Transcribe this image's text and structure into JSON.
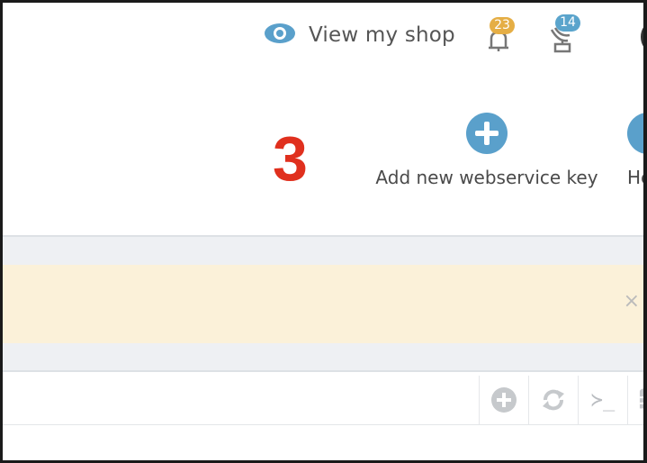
{
  "header": {
    "view_shop_label": "View my shop",
    "notifications_count": "23",
    "customers_count": "14",
    "icons": [
      "eye-icon",
      "bell-icon",
      "customers-icon",
      "avatar-icon"
    ]
  },
  "annotation": {
    "step_number": "3"
  },
  "toolbar": {
    "add_key_label": "Add new webservice key",
    "help_label": "He"
  },
  "alert": {
    "close_symbol": "×"
  },
  "panel": {
    "tools": [
      "add-icon",
      "refresh-icon",
      "sql-query-icon",
      "database-icon"
    ],
    "sql_symbol": "≻_"
  },
  "colors": {
    "accent_blue": "#5aa0cb",
    "badge_orange": "#e5ae45",
    "badge_blue": "#5aa4cc",
    "alert_bg": "#fbf1d9",
    "annotation_red": "#e0301e"
  }
}
